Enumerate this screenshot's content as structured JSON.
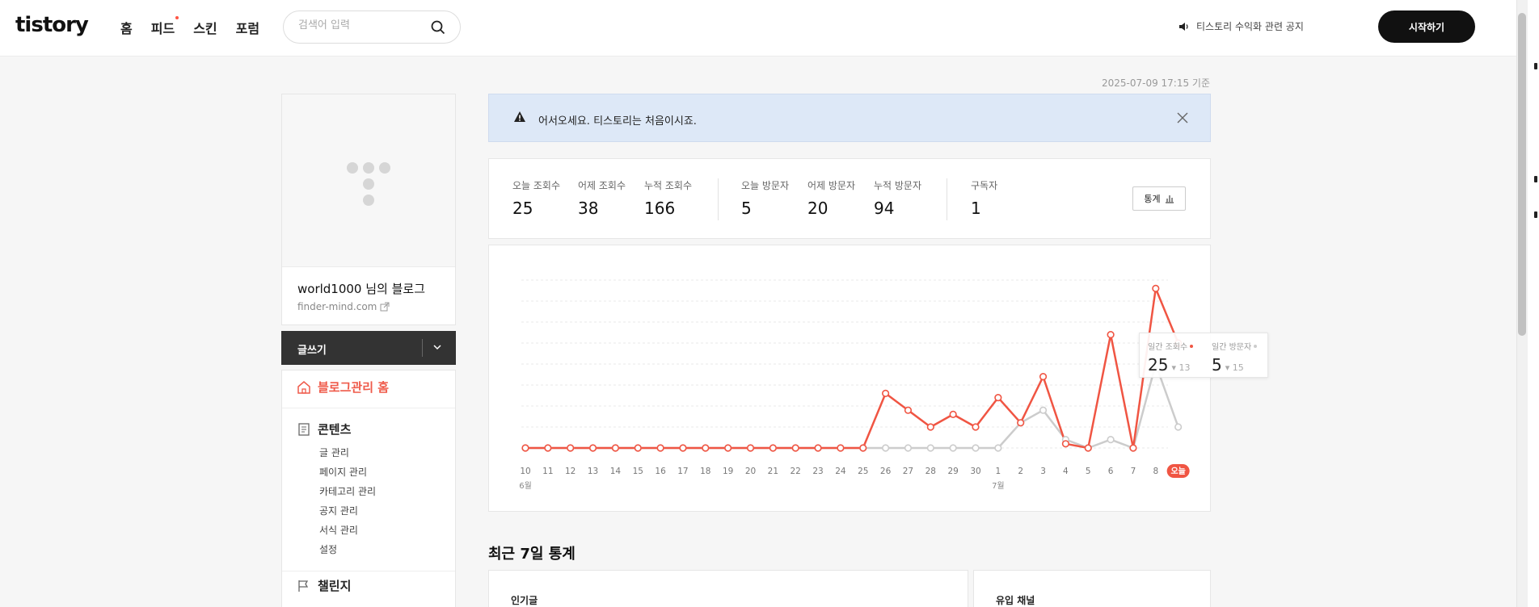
{
  "header": {
    "logo": "tistory",
    "nav": [
      "홈",
      "피드",
      "스킨",
      "포럼"
    ],
    "search_placeholder": "검색어 입력",
    "notice": "티스토리 수익화 관련 공지",
    "start_button": "시작하기"
  },
  "timestamp": "2025-07-09 17:15 기준",
  "sidebar": {
    "blog_name": "world1000 님의 블로그",
    "blog_url": "finder-mind.com",
    "write_button": "글쓰기",
    "menu_home": "블로그관리 홈",
    "menu_contents": "콘텐츠",
    "submenu": [
      "글 관리",
      "페이지 관리",
      "카테고리 관리",
      "공지 관리",
      "서식 관리",
      "설정"
    ],
    "menu_challenge": "챌린지"
  },
  "alert": {
    "text": "어서오세요. 티스토리는 처음이시죠."
  },
  "stats": [
    {
      "label": "오늘 조회수",
      "value": "25"
    },
    {
      "label": "어제 조회수",
      "value": "38"
    },
    {
      "label": "누적 조회수",
      "value": "166"
    },
    {
      "label": "오늘 방문자",
      "value": "5"
    },
    {
      "label": "어제 방문자",
      "value": "20"
    },
    {
      "label": "누적 방문자",
      "value": "94"
    },
    {
      "label": "구독자",
      "value": "1"
    }
  ],
  "stats_button": "통계",
  "tooltip": {
    "views_label": "일간 조회수",
    "views_value": "25",
    "views_delta": "13",
    "visitors_label": "일간 방문자",
    "visitors_value": "5",
    "visitors_delta": "15"
  },
  "chart_data": {
    "type": "line",
    "categories": [
      "10",
      "11",
      "12",
      "13",
      "14",
      "15",
      "16",
      "17",
      "18",
      "19",
      "20",
      "21",
      "22",
      "23",
      "24",
      "25",
      "26",
      "27",
      "28",
      "29",
      "30",
      "1",
      "2",
      "3",
      "4",
      "5",
      "6",
      "7",
      "8",
      "오늘"
    ],
    "month_labels": [
      {
        "at": 0,
        "label": "6월"
      },
      {
        "at": 21,
        "label": "7월"
      }
    ],
    "series": [
      {
        "name": "일간 조회수",
        "color": "#f05543",
        "values": [
          0,
          0,
          0,
          0,
          0,
          0,
          0,
          0,
          0,
          0,
          0,
          0,
          0,
          0,
          0,
          0,
          13,
          9,
          5,
          8,
          5,
          12,
          6,
          17,
          1,
          0,
          27,
          0,
          38,
          25
        ]
      },
      {
        "name": "일간 방문자",
        "color": "#cccccc",
        "values": [
          0,
          0,
          0,
          0,
          0,
          0,
          0,
          0,
          0,
          0,
          0,
          0,
          0,
          0,
          0,
          0,
          0,
          0,
          0,
          0,
          0,
          0,
          6,
          9,
          2,
          0,
          2,
          0,
          20,
          5
        ]
      }
    ],
    "ylim": [
      0,
      40
    ],
    "grid": true,
    "highlight_category": "오늘"
  },
  "section_title": "최근 7일 통계",
  "bottom_cards": [
    "인기글",
    "유입 채널"
  ]
}
